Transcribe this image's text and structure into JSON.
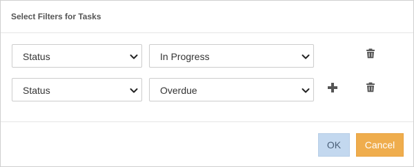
{
  "dialog": {
    "title": "Select Filters for Tasks",
    "ok_label": "OK",
    "cancel_label": "Cancel"
  },
  "filters": [
    {
      "field": "Status",
      "value": "In Progress",
      "show_add": false
    },
    {
      "field": "Status",
      "value": "Overdue",
      "show_add": true
    }
  ],
  "icons": {
    "dropdown": "chevron-down-icon",
    "add": "plus-icon",
    "delete": "trash-icon"
  },
  "colors": {
    "ok_button": "#c3d8ef",
    "cancel_button": "#efad4d"
  }
}
